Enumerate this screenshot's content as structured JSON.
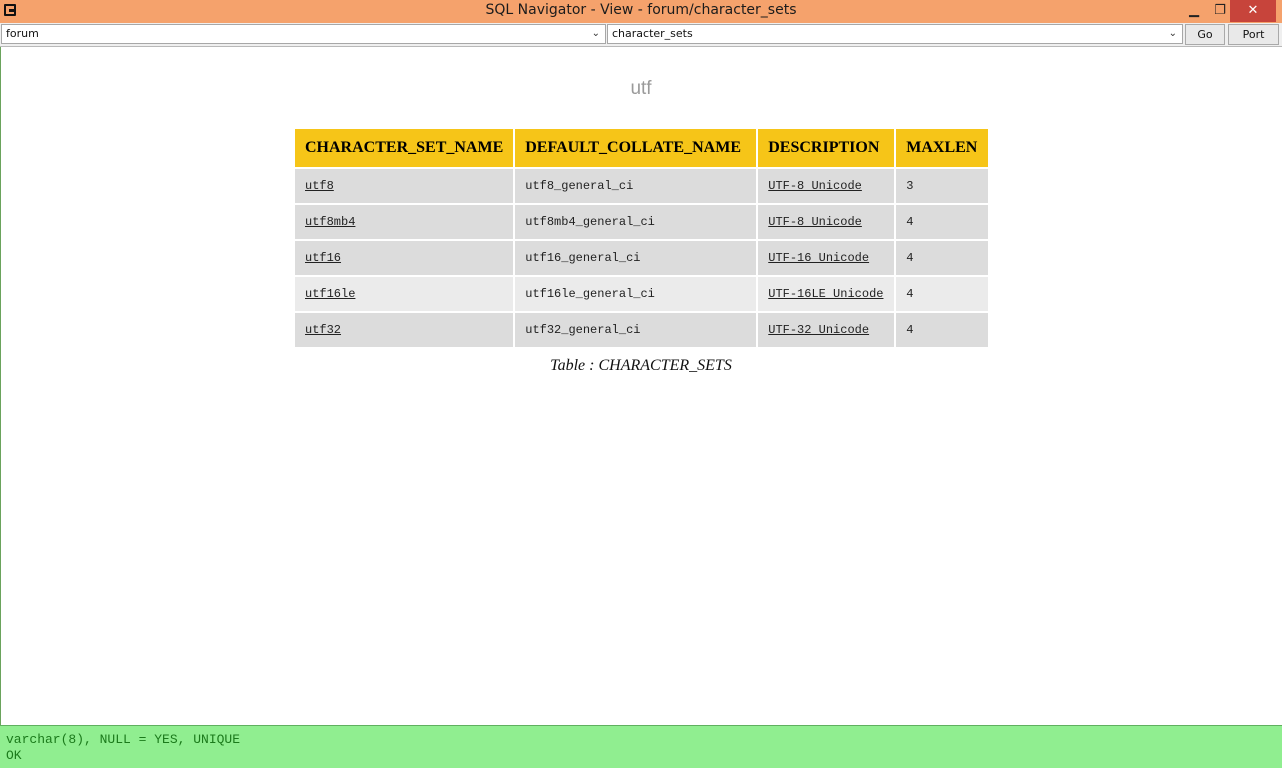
{
  "window": {
    "title": "SQL Navigator - View - forum/character_sets",
    "minimize_label": "▁",
    "maximize_label": "❐",
    "close_label": "✕"
  },
  "toolbar": {
    "database_value": "forum",
    "table_value": "character_sets",
    "go_label": "Go",
    "port_label": "Port"
  },
  "search": {
    "value": "utf"
  },
  "table": {
    "columns": [
      "CHARACTER_SET_NAME",
      "DEFAULT_COLLATE_NAME",
      "DESCRIPTION",
      "MAXLEN"
    ],
    "rows": [
      {
        "name": "utf8",
        "collate": "utf8_general_ci",
        "description": "UTF-8 Unicode",
        "maxlen": "3"
      },
      {
        "name": "utf8mb4",
        "collate": "utf8mb4_general_ci",
        "description": "UTF-8 Unicode",
        "maxlen": "4"
      },
      {
        "name": "utf16",
        "collate": "utf16_general_ci",
        "description": "UTF-16 Unicode",
        "maxlen": "4"
      },
      {
        "name": "utf16le",
        "collate": "utf16le_general_ci",
        "description": "UTF-16LE Unicode",
        "maxlen": "4"
      },
      {
        "name": "utf32",
        "collate": "utf32_general_ci",
        "description": "UTF-32 Unicode",
        "maxlen": "4"
      }
    ],
    "caption": "Table : CHARACTER_SETS"
  },
  "status": {
    "line1": "varchar(8), NULL = YES, UNIQUE",
    "line2": "OK"
  },
  "colors": {
    "titlebar": "#f5a26c",
    "header": "#f6c518",
    "status_bg": "#90ee90",
    "status_text": "#1b7a1b"
  }
}
